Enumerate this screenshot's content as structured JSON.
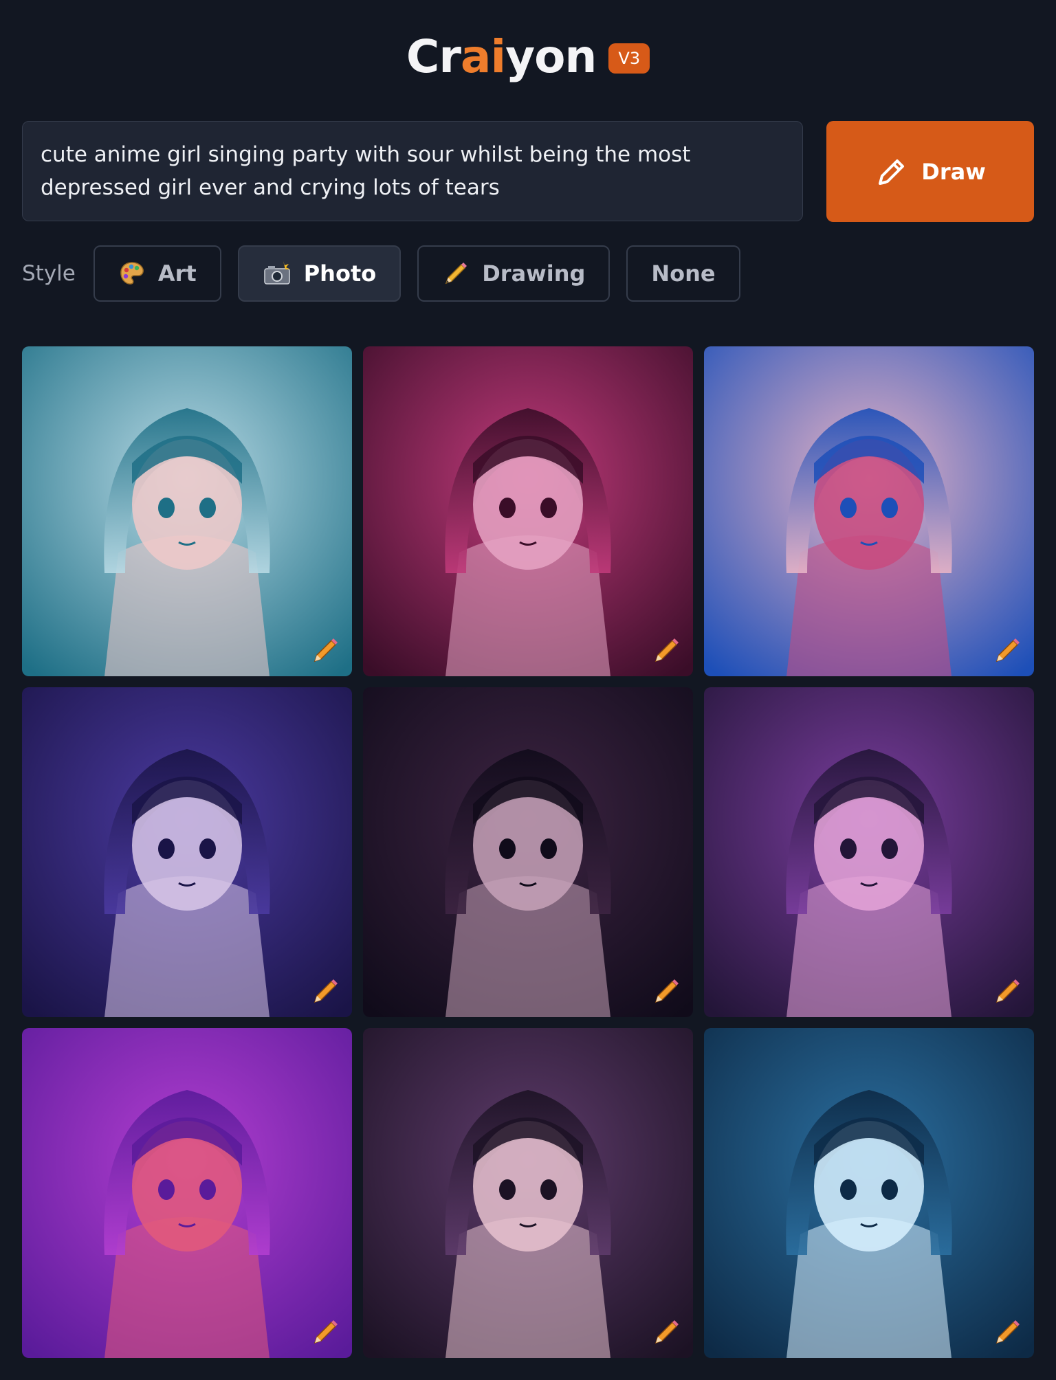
{
  "header": {
    "logo_pre": "Cr",
    "logo_accent1": "a",
    "logo_accent2": "i",
    "logo_post": "yon",
    "version": "V3"
  },
  "prompt": {
    "value": "cute anime girl singing party with sour whilst being the most depressed girl ever and crying lots of tears"
  },
  "draw_button": {
    "label": "Draw",
    "icon": "pencil-icon"
  },
  "style_selector": {
    "label": "Style",
    "options": [
      {
        "label": "Art",
        "icon": "palette-icon",
        "active": false
      },
      {
        "label": "Photo",
        "icon": "camera-flash-icon",
        "active": true
      },
      {
        "label": "Drawing",
        "icon": "pencil-icon",
        "active": false
      },
      {
        "label": "None",
        "icon": "",
        "active": false
      }
    ]
  },
  "results": {
    "count": 9,
    "edit_icon": "pencil-icon",
    "images": [
      {
        "description_colors": [
          "#1e6f86",
          "#b7d9e4",
          "#f0c9c9"
        ]
      },
      {
        "description_colors": [
          "#3a0d28",
          "#c03a7a",
          "#e6a5c4"
        ]
      },
      {
        "description_colors": [
          "#1d4fb8",
          "#e7b3c6",
          "#c84a7f"
        ]
      },
      {
        "description_colors": [
          "#1a1447",
          "#4b3aa0",
          "#d8c7e8"
        ]
      },
      {
        "description_colors": [
          "#100b1a",
          "#3d2442",
          "#c7a2b8"
        ]
      },
      {
        "description_colors": [
          "#231538",
          "#7a3d9e",
          "#e5a4d8"
        ]
      },
      {
        "description_colors": [
          "#5a1b9a",
          "#b23ed0",
          "#e35a7a"
        ]
      },
      {
        "description_colors": [
          "#1c1224",
          "#5e3b6b",
          "#e7c2cf"
        ]
      },
      {
        "description_colors": [
          "#0d2a46",
          "#2b6fa0",
          "#d8f1ff"
        ]
      }
    ]
  }
}
